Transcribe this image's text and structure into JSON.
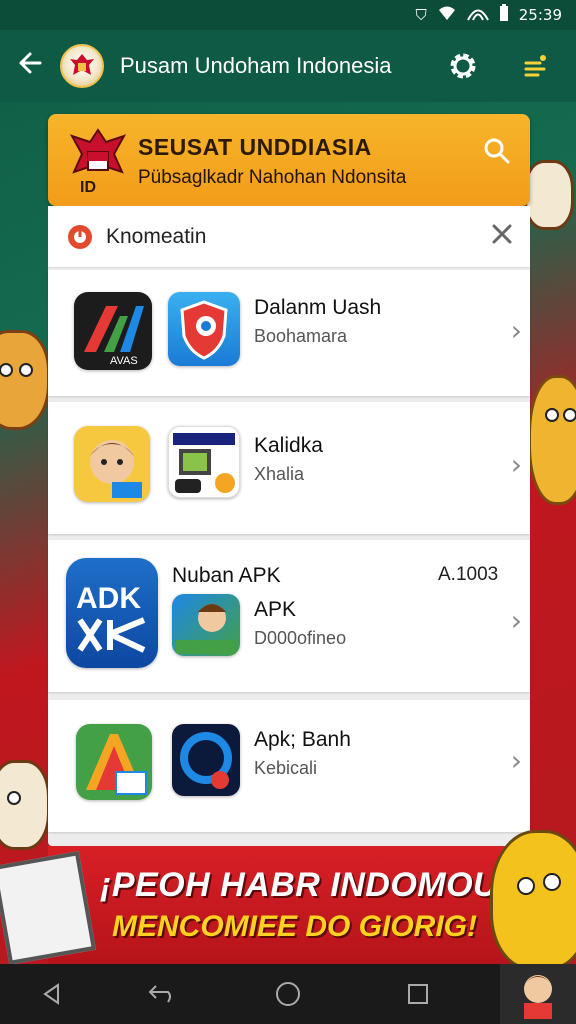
{
  "status_bar": {
    "time": "25:39"
  },
  "app_bar": {
    "title": "Pusam Undoham Indonesia"
  },
  "banner": {
    "title": "SEUSAT UNDDIASIA",
    "subtitle": "Pübsaglkadr Nahohan Ndonsita"
  },
  "panel": {
    "header_title": "Knomeatin",
    "rows": [
      {
        "title": "Dalanm Uash",
        "subtitle": "Boohamara",
        "big_icon_text": "AVAS",
        "chevron": "›"
      },
      {
        "title": "Kalidka",
        "subtitle": "Xhalia",
        "chevron": "›"
      },
      {
        "title": "Nuban APK",
        "title2": "APK",
        "subtitle": "D000ofineo",
        "version": "A.1003",
        "big_icon_text": "ADK",
        "chevron": "›"
      },
      {
        "title": "Apk; Banh",
        "subtitle": "Kebicali",
        "chevron": "›"
      }
    ]
  },
  "promo": {
    "line1": "¡PEOH HABR INDOMOU!",
    "line2": "MENCOMIEE DO GIORIG!"
  },
  "colors": {
    "status_bar": "#0c4d3a",
    "app_bar": "#0f5a44",
    "banner": "#f7b52a",
    "promo": "#d81f26",
    "accent_red": "#c8102e"
  },
  "icons": {
    "back": "back-arrow-icon",
    "settings": "gear-icon",
    "menu": "menu-icon",
    "search": "search-icon",
    "close": "close-icon"
  }
}
